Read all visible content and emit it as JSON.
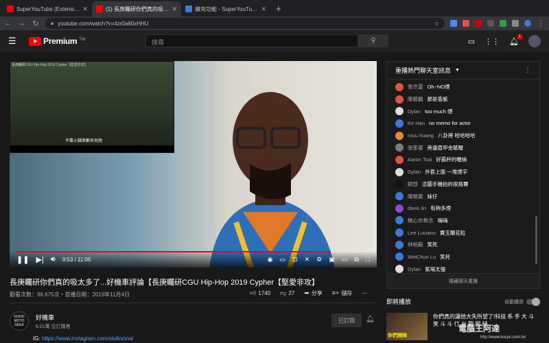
{
  "browser": {
    "tabs": [
      {
        "title": "SuperYouTube (Extension for You",
        "active": false,
        "favicon": "youtube-icon"
      },
      {
        "title": "(1) 長庚矚研你們真的吸太多",
        "active": true,
        "favicon": "youtube-icon"
      },
      {
        "title": "擴充功能 - SuperYouTube (Exte",
        "active": false,
        "favicon": "extension-icon"
      }
    ],
    "new_tab": "+",
    "url": "youtube.com/watch?v=4zr0a60xHHU"
  },
  "header": {
    "logo_text": "Premium",
    "logo_region": "TW",
    "search_placeholder": "搜尋",
    "notification_count": "1"
  },
  "player": {
    "current_time": "9:53",
    "duration": "11:06",
    "progress_fraction": 0.89,
    "pip_title": "長庚矚研CGU Hip-Hop 2019 Cypher【堅愛非攻】",
    "pip_subtitle": "不靠火鍋串都有何用"
  },
  "video": {
    "title": "長庚矚研你們真的吸太多了...好機車評論【長庚矚研CGU Hip-Hop 2019 Cypher【堅愛非攻】",
    "views_date": "觀看次數：96,675次・首播日期：2019年11月4日",
    "likes": "1740",
    "dislikes": "27",
    "share": "分享",
    "save": "儲存"
  },
  "channel": {
    "avatar_text": "GOOD MOTO GEEK",
    "name": "好機車",
    "subscribers": "6.01萬 位訂閱者",
    "subscribe_label": "已訂閱",
    "description_prefix": "IG: ",
    "description_link": "https://www.instagram.com/stalksona/"
  },
  "chat": {
    "header": "重播熱門聊天室訊息",
    "footer": "隱藏聊天重播",
    "messages": [
      {
        "author": "張世霆",
        "text": "Oh~NO煙",
        "color": "#e0533a"
      },
      {
        "author": "陳藝鵬",
        "text": "那是香脈",
        "color": "#e0533a"
      },
      {
        "author": "Dylan",
        "text": "too much 煙",
        "color": "#dddddd"
      },
      {
        "author": "Ke Han",
        "text": "no memo for actor",
        "color": "#3a7bd5"
      },
      {
        "author": "rouu huang",
        "text": "八卦將 哈哈哈哈",
        "color": "#e08a3a"
      },
      {
        "author": "張峯睿",
        "text": "旁邊眉甲金賦喔",
        "color": "#7a7a7a"
      },
      {
        "author": "Aaron Tsai",
        "text": "好霸杯的喔納",
        "color": "#e0533a"
      },
      {
        "author": "Dylan",
        "text": "外套上面 一堆煙字",
        "color": "#dddddd"
      },
      {
        "author": "銅部",
        "text": "這圖手機拍的很烙賽",
        "color": "#111111"
      },
      {
        "author": "陳曉東",
        "text": "妹仔",
        "color": "#3a7bd5"
      },
      {
        "author": "davis lin",
        "text": "有夠多煙",
        "color": "#8a4ad5"
      },
      {
        "author": "無心亦無念",
        "text": "嗨嗨",
        "color": "#3a7bd5"
      },
      {
        "author": "Lee Luciano",
        "text": "賣玉蘭花粒",
        "color": "#3a7bd5"
      },
      {
        "author": "林柏毅",
        "text": "笑死",
        "color": "#3a7bd5"
      },
      {
        "author": "WeiChun Lu",
        "text": "笑死",
        "color": "#3a7bd5"
      },
      {
        "author": "Dylan",
        "text": "氣場太強",
        "color": "#dddddd"
      }
    ]
  },
  "up_next": {
    "label": "即將播放",
    "autoplay_label": "自動播放",
    "thumb_text": "你們開除",
    "title": "你們真的讓他大失所望了!科技 系 手 大 斗 笑 斗 斗 仃 台 觀 國 頻"
  },
  "watermark": {
    "main": "電腦王阿達",
    "sub": "http://www.kocpc.com.tw"
  }
}
